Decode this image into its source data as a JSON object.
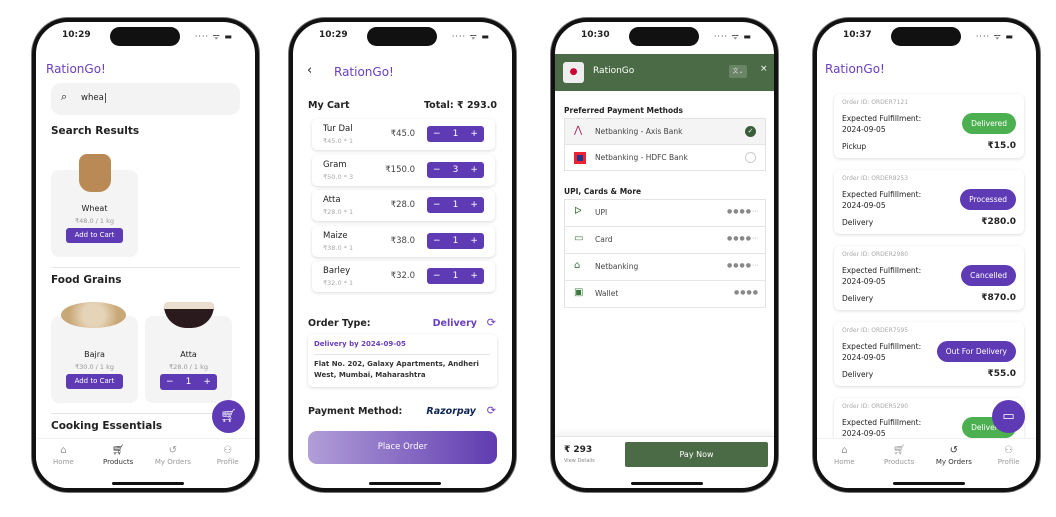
{
  "colors": {
    "primary": "#5e3bb5",
    "brand": "#6a3fc1",
    "green": "#4caf50",
    "razorpay_green": "#4a6b45"
  },
  "screen1": {
    "time": "10:29",
    "brand": "RationGo!",
    "search": {
      "value": "whea",
      "icon": "search-icon"
    },
    "search_results_title": "Search Results",
    "search_results": [
      {
        "name": "Wheat",
        "price": "₹48.0 / 1 kg",
        "button": "Add to Cart"
      }
    ],
    "food_grains_title": "Food Grains",
    "food_grains": [
      {
        "name": "Bajra",
        "price": "₹30.0 / 1 kg",
        "button": "Add to Cart"
      },
      {
        "name": "Atta",
        "price": "₹28.0 / 1 kg",
        "qty": "1",
        "minus": "−",
        "plus": "+"
      }
    ],
    "cooking_title": "Cooking Essentials",
    "cart_fab_icon": "cart-icon",
    "nav": [
      {
        "label": "Home",
        "icon": "home-icon"
      },
      {
        "label": "Products",
        "icon": "cart-icon"
      },
      {
        "label": "My Orders",
        "icon": "history-icon"
      },
      {
        "label": "Profile",
        "icon": "profile-icon"
      }
    ],
    "active": "Products"
  },
  "screen2": {
    "time": "10:29",
    "brand": "RationGo!",
    "cart_title": "My Cart",
    "total": "Total: ₹ 293.0",
    "items": [
      {
        "name": "Tur Dal",
        "sub": "₹45.0 * 1",
        "price": "₹45.0",
        "qty": "1"
      },
      {
        "name": "Gram",
        "sub": "₹50.0 * 3",
        "price": "₹150.0",
        "qty": "3"
      },
      {
        "name": "Atta",
        "sub": "₹28.0 * 1",
        "price": "₹28.0",
        "qty": "1"
      },
      {
        "name": "Maize",
        "sub": "₹38.0 * 1",
        "price": "₹38.0",
        "qty": "1"
      },
      {
        "name": "Barley",
        "sub": "₹32.0 * 1",
        "price": "₹32.0",
        "qty": "1"
      }
    ],
    "minus": "−",
    "plus": "+",
    "order_type_label": "Order Type:",
    "order_type": "Delivery",
    "delivery_by": "Delivery by 2024-09-05",
    "address": "Flat No. 202, Galaxy Apartments, Andheri West, Mumbai, Maharashtra",
    "payment_label": "Payment Method:",
    "payment_provider": "Razorpay",
    "place_order": "Place Order"
  },
  "screen3": {
    "time": "10:30",
    "merchant": "RationGo",
    "close": "×",
    "preferred_title": "Preferred Payment Methods",
    "preferred": [
      {
        "label": "Netbanking - Axis Bank",
        "selected": true
      },
      {
        "label": "Netbanking - HDFC Bank",
        "selected": false
      }
    ],
    "more_title": "UPI, Cards & More",
    "methods": [
      {
        "label": "UPI",
        "icon": "upi-icon"
      },
      {
        "label": "Card",
        "icon": "card-icon"
      },
      {
        "label": "Netbanking",
        "icon": "bank-icon"
      },
      {
        "label": "Wallet",
        "icon": "wallet-icon"
      }
    ],
    "amount": "₹ 293",
    "view_details": "View Details",
    "pay_now": "Pay Now"
  },
  "screen4": {
    "time": "10:37",
    "brand": "RationGo!",
    "orders": [
      {
        "id": "Order ID: ORDER7121",
        "expected": "Expected Fulfillment:",
        "date": "2024-09-05",
        "type": "Pickup",
        "price": "₹15.0",
        "status": "Delivered",
        "status_color": "#4caf50"
      },
      {
        "id": "Order ID: ORDER8253",
        "expected": "Expected Fulfillment:",
        "date": "2024-09-05",
        "type": "Delivery",
        "price": "₹280.0",
        "status": "Processed",
        "status_color": "#5e3bb5"
      },
      {
        "id": "Order ID: ORDER2980",
        "expected": "Expected Fulfillment:",
        "date": "2024-09-05",
        "type": "Delivery",
        "price": "₹870.0",
        "status": "Cancelled",
        "status_color": "#5e3bb5"
      },
      {
        "id": "Order ID: ORDER7595",
        "expected": "Expected Fulfillment:",
        "date": "2024-09-05",
        "type": "Delivery",
        "price": "₹55.0",
        "status": "Out For Delivery",
        "status_color": "#5e3bb5"
      },
      {
        "id": "Order ID: ORDER5290",
        "expected": "Expected Fulfillment:",
        "date": "2024-09-05",
        "type": "",
        "price": "",
        "status": "Delivered",
        "status_color": "#4caf50"
      }
    ],
    "chat_fab_icon": "chat-icon",
    "active": "My Orders"
  }
}
